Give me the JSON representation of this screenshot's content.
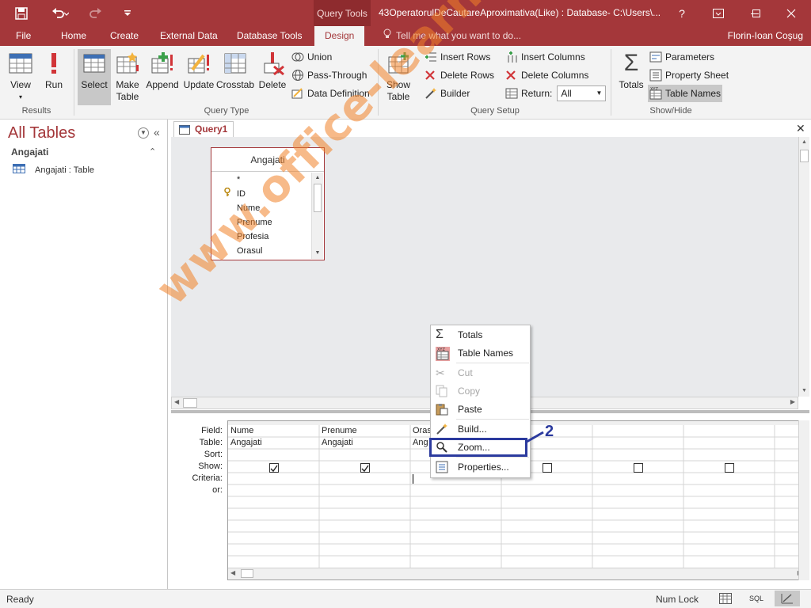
{
  "titlebar": {
    "context_tab": "Query Tools",
    "document_title": "43OperatorulDeCautareAproximativa(Like) : Database- C:\\Users\\...",
    "help": "?"
  },
  "tabs": [
    "File",
    "Home",
    "Create",
    "External Data",
    "Database Tools",
    "Design"
  ],
  "active_tab": "Design",
  "tell_me": "Tell me what you want to do...",
  "user": "Florin-Ioan Coşug",
  "ribbon": {
    "results": {
      "label": "Results",
      "view": "View",
      "run": "Run"
    },
    "query_type": {
      "label": "Query Type",
      "select": "Select",
      "make_table_1": "Make",
      "make_table_2": "Table",
      "append": "Append",
      "update": "Update",
      "crosstab": "Crosstab",
      "delete": "Delete",
      "union": "Union",
      "pass_through": "Pass-Through",
      "data_definition": "Data Definition"
    },
    "query_setup": {
      "label": "Query Setup",
      "show_table_1": "Show",
      "show_table_2": "Table",
      "insert_rows": "Insert Rows",
      "delete_rows": "Delete Rows",
      "builder": "Builder",
      "insert_columns": "Insert Columns",
      "delete_columns": "Delete Columns",
      "return_label": "Return:",
      "return_value": "All"
    },
    "show_hide": {
      "label": "Show/Hide",
      "totals": "Totals",
      "parameters": "Parameters",
      "property_sheet": "Property Sheet",
      "table_names": "Table Names"
    }
  },
  "nav": {
    "title": "All Tables",
    "group": "Angajati",
    "item": "Angajati : Table"
  },
  "doc_tab": "Query1",
  "table_box": {
    "name": "Angajati",
    "fields": [
      "*",
      "ID",
      "Nume",
      "Prenume",
      "Profesia",
      "Orasul"
    ]
  },
  "grid": {
    "row_labels": [
      "Field:",
      "Table:",
      "Sort:",
      "Show:",
      "Criteria:",
      "or:"
    ],
    "columns": [
      {
        "field": "Nume",
        "table": "Angajati",
        "show": true
      },
      {
        "field": "Prenume",
        "table": "Angajati",
        "show": true
      },
      {
        "field": "Oras",
        "table": "Ang",
        "show": false
      },
      {
        "field": "",
        "table": "",
        "show": true
      },
      {
        "field": "",
        "table": "",
        "show": true
      },
      {
        "field": "",
        "table": "",
        "show": true
      }
    ]
  },
  "context_menu": {
    "items": [
      {
        "label": "Totals",
        "enabled": true
      },
      {
        "label": "Table Names",
        "enabled": true
      },
      {
        "label": "Cut",
        "enabled": false
      },
      {
        "label": "Copy",
        "enabled": false
      },
      {
        "label": "Paste",
        "enabled": true
      },
      {
        "label": "Build...",
        "enabled": true
      },
      {
        "label": "Zoom...",
        "enabled": true
      },
      {
        "label": "Properties...",
        "enabled": true
      }
    ],
    "callout_number": "2"
  },
  "status": {
    "left": "Ready",
    "num_lock": "Num Lock",
    "sql": "SQL"
  },
  "watermark": "www.office-learning.ro",
  "colors": {
    "accent": "#a4373a",
    "highlight_box": "#2b3a9e",
    "watermark": "#f08228"
  }
}
